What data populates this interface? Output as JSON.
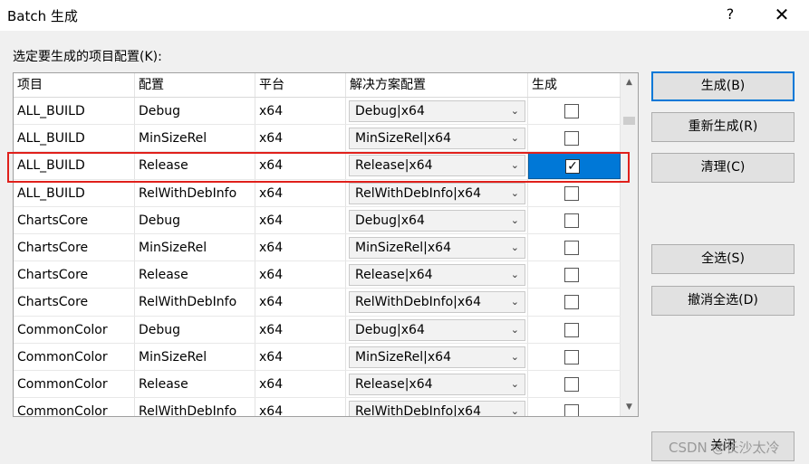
{
  "window": {
    "title": "Batch 生成",
    "help_label": "?",
    "close_label": "✕"
  },
  "prompt": "选定要生成的项目配置(K):",
  "columns": [
    "项目",
    "配置",
    "平台",
    "解决方案配置",
    "生成"
  ],
  "rows": [
    {
      "project": "ALL_BUILD",
      "config": "Debug",
      "platform": "x64",
      "solution_config": "Debug|x64",
      "build": ""
    },
    {
      "project": "ALL_BUILD",
      "config": "MinSizeRel",
      "platform": "x64",
      "solution_config": "MinSizeRel|x64",
      "build": ""
    },
    {
      "project": "ALL_BUILD",
      "config": "Release",
      "platform": "x64",
      "solution_config": "Release|x64",
      "build": "✓"
    },
    {
      "project": "ALL_BUILD",
      "config": "RelWithDebInfo",
      "platform": "x64",
      "solution_config": "RelWithDebInfo|x64",
      "build": ""
    },
    {
      "project": "ChartsCore",
      "config": "Debug",
      "platform": "x64",
      "solution_config": "Debug|x64",
      "build": ""
    },
    {
      "project": "ChartsCore",
      "config": "MinSizeRel",
      "platform": "x64",
      "solution_config": "MinSizeRel|x64",
      "build": ""
    },
    {
      "project": "ChartsCore",
      "config": "Release",
      "platform": "x64",
      "solution_config": "Release|x64",
      "build": ""
    },
    {
      "project": "ChartsCore",
      "config": "RelWithDebInfo",
      "platform": "x64",
      "solution_config": "RelWithDebInfo|x64",
      "build": ""
    },
    {
      "project": "CommonColor",
      "config": "Debug",
      "platform": "x64",
      "solution_config": "Debug|x64",
      "build": ""
    },
    {
      "project": "CommonColor",
      "config": "MinSizeRel",
      "platform": "x64",
      "solution_config": "MinSizeRel|x64",
      "build": ""
    },
    {
      "project": "CommonColor",
      "config": "Release",
      "platform": "x64",
      "solution_config": "Release|x64",
      "build": ""
    },
    {
      "project": "CommonColor",
      "config": "RelWithDebInfo",
      "platform": "x64",
      "solution_config": "RelWithDebInfo|x64",
      "build": ""
    }
  ],
  "buttons": {
    "build": "生成(B)",
    "rebuild": "重新生成(R)",
    "clean": "清理(C)",
    "select_all": "全选(S)",
    "deselect_all": "撤消全选(D)",
    "close": "关闭"
  },
  "watermark": "CSDN @长沙太冷",
  "icons": {
    "dropdown": "chevron-down-icon",
    "checkmark": "check-icon"
  },
  "colors": {
    "selection": "#0078d7",
    "highlight_box": "#e0201b",
    "default_button_border": "#0078d7"
  }
}
